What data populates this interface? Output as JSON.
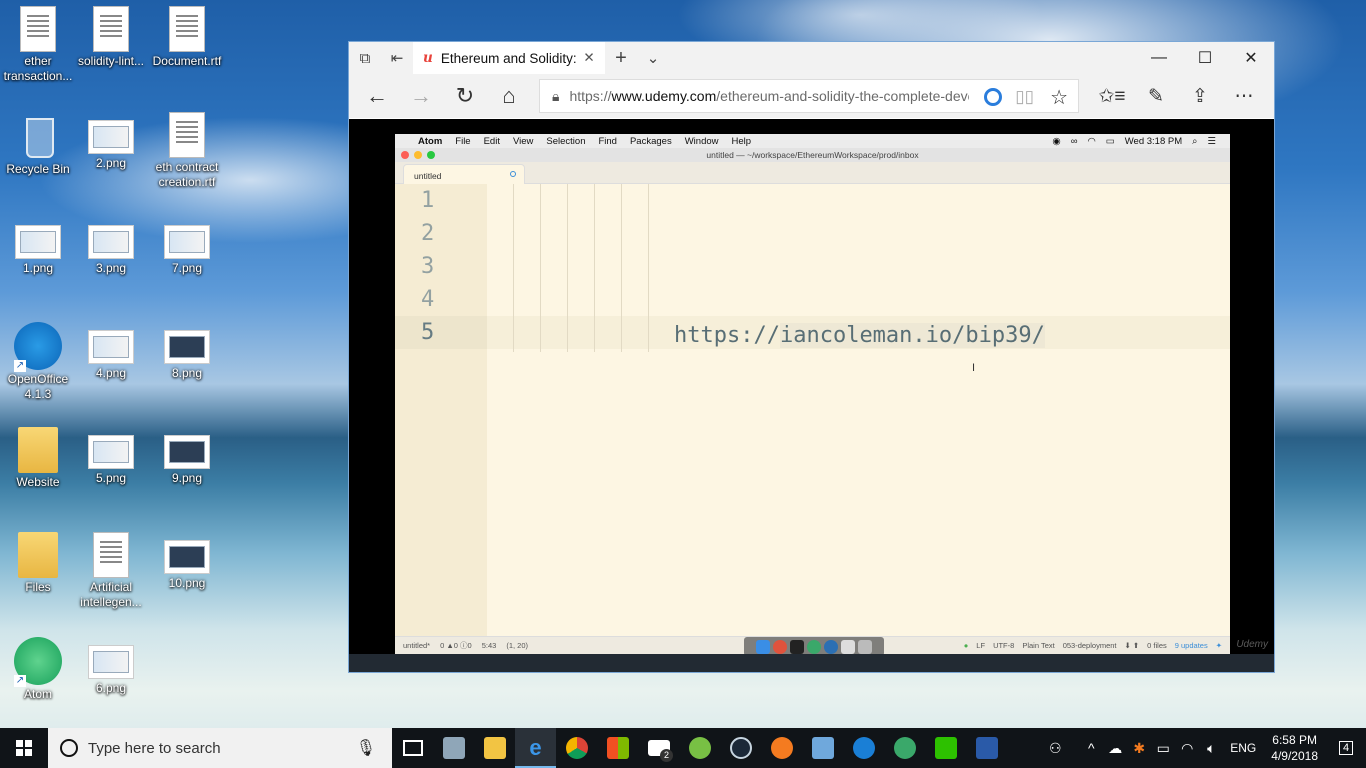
{
  "desktop": {
    "icons": [
      {
        "label": "ether transaction...",
        "kind": "doc"
      },
      {
        "label": "solidity-lint...",
        "kind": "doc"
      },
      {
        "label": "Document.rtf",
        "kind": "doc"
      },
      {
        "label": "Recycle Bin",
        "kind": "bin"
      },
      {
        "label": "2.png",
        "kind": "img"
      },
      {
        "label": "eth contract creation.rtf",
        "kind": "doc"
      },
      {
        "label": "1.png",
        "kind": "img"
      },
      {
        "label": "3.png",
        "kind": "img"
      },
      {
        "label": "7.png",
        "kind": "img"
      },
      {
        "label": "OpenOffice 4.1.3",
        "kind": "openoffice"
      },
      {
        "label": "4.png",
        "kind": "img"
      },
      {
        "label": "8.png",
        "kind": "img"
      },
      {
        "label": "Website",
        "kind": "folder"
      },
      {
        "label": "5.png",
        "kind": "img"
      },
      {
        "label": "9.png",
        "kind": "img"
      },
      {
        "label": "Files",
        "kind": "folder"
      },
      {
        "label": "Artificial intellegen...",
        "kind": "doc"
      },
      {
        "label": "10.png",
        "kind": "img"
      },
      {
        "label": "Atom",
        "kind": "atom"
      },
      {
        "label": "6.png",
        "kind": "img"
      }
    ]
  },
  "browser": {
    "tab_title": "Ethereum and Solidity: T",
    "tab_icon": "u",
    "url_prefix": "https://",
    "url_host": "www.udemy.com",
    "url_path": "/ethereum-and-solidity-the-complete-develc",
    "window_controls": {
      "minimize": "—",
      "maximize": "☐",
      "close": "✕"
    }
  },
  "mac": {
    "menu": [
      "Atom",
      "File",
      "Edit",
      "View",
      "Selection",
      "Find",
      "Packages",
      "Window",
      "Help"
    ],
    "clock": "Wed 3:18 PM",
    "window_title": "untitled — ~/workspace/EthereumWorkspace/prod/inbox",
    "tab_label": "untitled",
    "line_numbers": [
      "1",
      "2",
      "3",
      "4",
      "5"
    ],
    "code_prefix": "https://",
    "code_selected": "iancoleman.io/bip39/",
    "status": {
      "file": "untitled*",
      "problems": "0 ▲0 ⓘ0",
      "time": "5:43",
      "position": "(1, 20)",
      "line_ending": "LF",
      "encoding": "UTF-8",
      "grammar": "Plain Text",
      "branch": "053-deployment",
      "files": "0 files",
      "updates": "9 updates"
    },
    "watermark": "Udemy"
  },
  "taskbar": {
    "search_placeholder": "Type here to search",
    "language": "ENG",
    "time": "6:58 PM",
    "date": "4/9/2018",
    "notification_count": "4",
    "mail_badge": "2"
  },
  "colors": {
    "accent": "#76b9ed",
    "udemy": "#e8433b",
    "editor_bg": "#fdf6e3"
  }
}
